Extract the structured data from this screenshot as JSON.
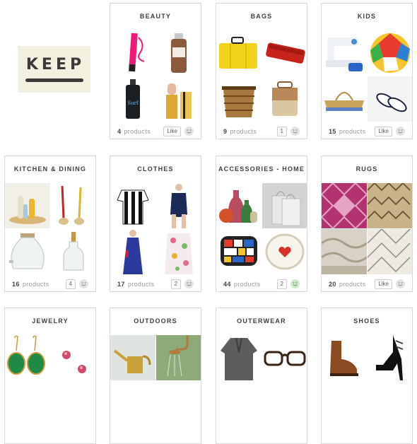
{
  "logo": {
    "text": "KEEP"
  },
  "cards": [
    {
      "title": "BEAUTY",
      "count": "4",
      "count_label": "products",
      "action": "Like",
      "smile": "grey"
    },
    {
      "title": "BAGS",
      "count": "9",
      "count_label": "products",
      "action": "1",
      "smile": "grey"
    },
    {
      "title": "KIDS",
      "count": "15",
      "count_label": "products",
      "action": "Like",
      "smile": "grey"
    },
    {
      "title": "KITCHEN & DINING",
      "count": "16",
      "count_label": "products",
      "action": "4",
      "smile": "grey"
    },
    {
      "title": "CLOTHES",
      "count": "17",
      "count_label": "products",
      "action": "2",
      "smile": "grey"
    },
    {
      "title": "ACCESSORIES - HOME",
      "count": "44",
      "count_label": "products",
      "action": "2",
      "smile": "green"
    },
    {
      "title": "RUGS",
      "count": "20",
      "count_label": "products",
      "action": "Like",
      "smile": "grey"
    },
    {
      "title": "JEWELRY"
    },
    {
      "title": "OUTDOORS"
    },
    {
      "title": "OUTERWEAR"
    },
    {
      "title": "SHOES"
    }
  ],
  "colors": {
    "border": "#d8d8d8",
    "logo_bg": "#f3f0e0",
    "text": "#3e3e3e",
    "muted": "#9a9a9a"
  }
}
